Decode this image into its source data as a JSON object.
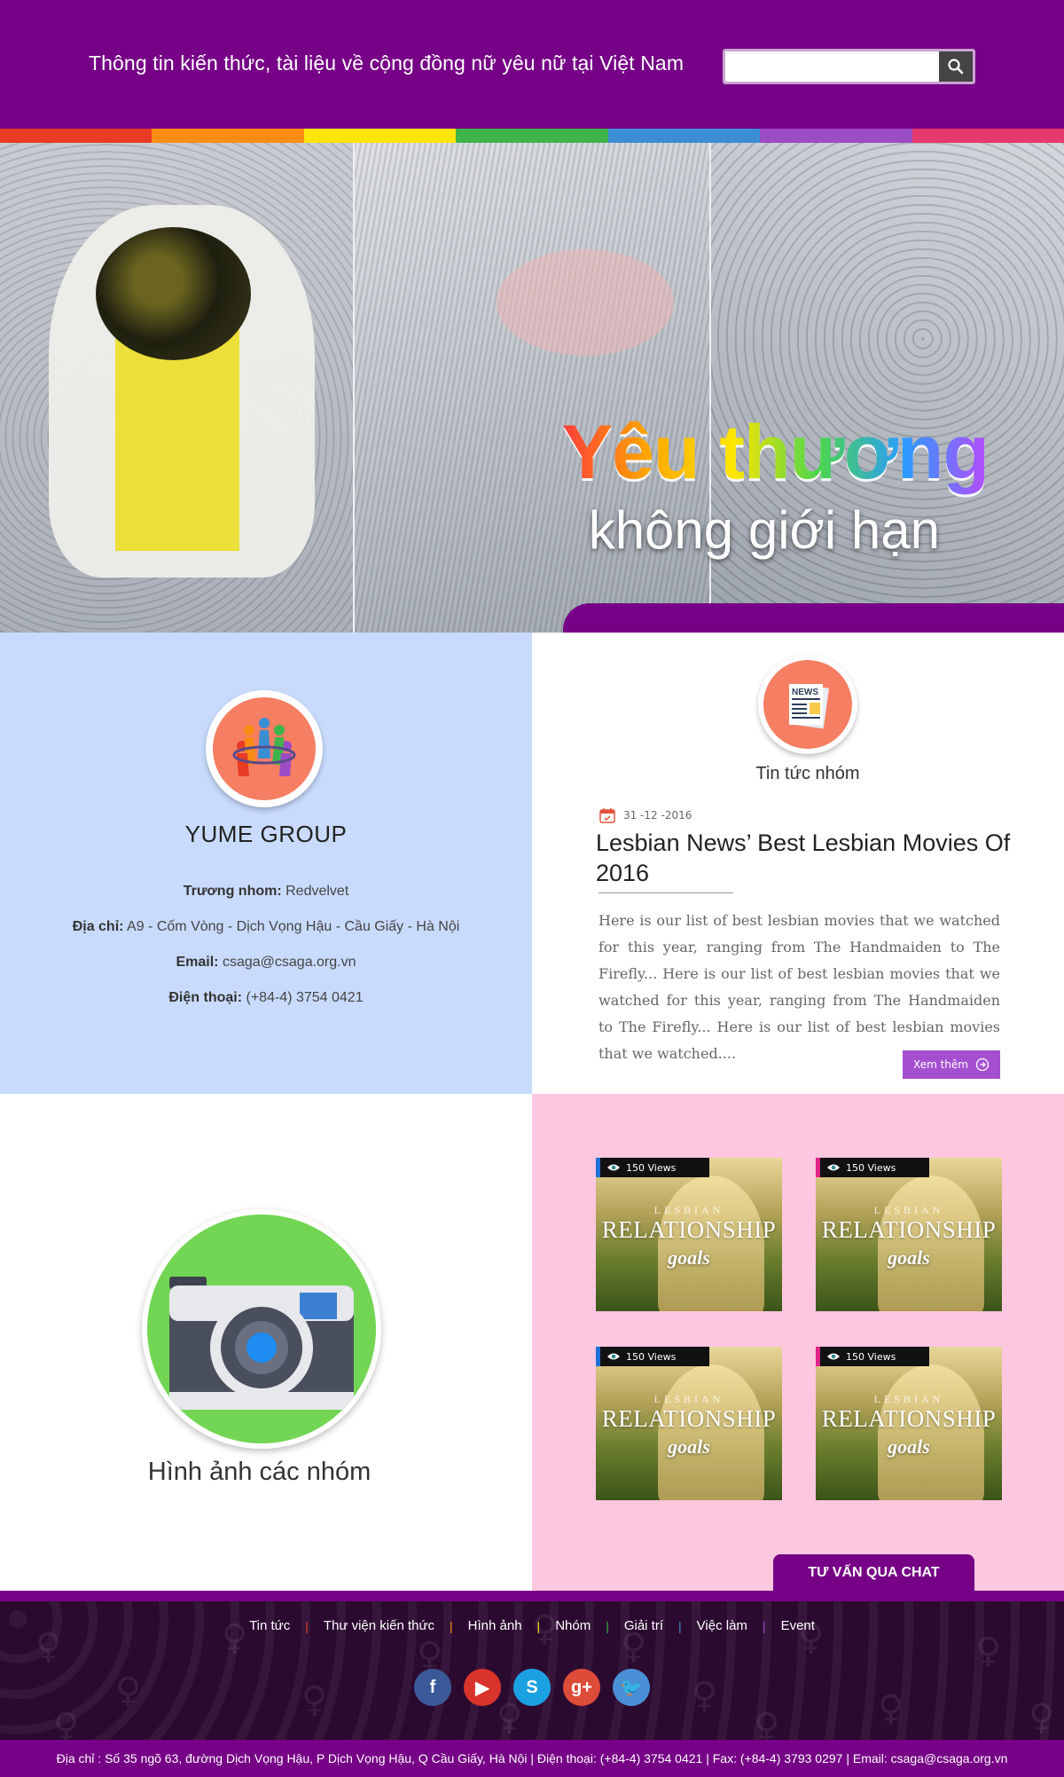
{
  "colors": {
    "header_bg": "#760086",
    "rainbow": [
      "#e83c24",
      "#fb8c14",
      "#fde50b",
      "#3fb44a",
      "#3a8fd4",
      "#9c4cc4",
      "#e53a6e"
    ],
    "group_bg": "#c8dbfd",
    "photos_bg": "#fdc7e0",
    "accent_button": "#a44fd0",
    "icon_orange": "#f57e63",
    "camera_green": "#72d654"
  },
  "header": {
    "title": "Thông tin kiến thức, tài liệu về cộng đồng nữ yêu nữ tại Việt Nam",
    "search": {
      "placeholder": "",
      "icon": "search-icon"
    }
  },
  "hero": {
    "line1": "Yêu thương",
    "line2": "không giới hạn"
  },
  "group": {
    "name": "YUME GROUP",
    "leader_label": "Trương nhom:",
    "leader_value": "Redvelvet",
    "address_label": "Địa chỉ:",
    "address_value": "A9 - Cốm Vòng - Dịch Vọng Hậu - Cầu Giấy - Hà Nội",
    "email_label": "Email:",
    "email_value": "csaga@csaga.org.vn",
    "phone_label": "Điện thoại:",
    "phone_value": "(+84-4) 3754 0421"
  },
  "news": {
    "heading": "Tin tức nhóm",
    "date": "31 -12 -2016",
    "title": "Lesbian News’ Best Lesbian Movies Of 2016",
    "excerpt": "Here is our list of best lesbian movies that we watched for this year, ranging from The Handmaiden to The Firefly... Here is our list of best lesbian movies that we watched for this year, ranging from The Handmaiden to The Firefly... Here is our list of best lesbian movies that we watched....",
    "more_label": "Xem thêm"
  },
  "photos": {
    "heading": "Hình ảnh các nhóm",
    "items": [
      {
        "views": "150 Views",
        "small": "LESBIAN",
        "big": "RELATIONSHIP",
        "script": "goals",
        "bar_color": "#1f6fd9"
      },
      {
        "views": "150 Views",
        "small": "LESBIAN",
        "big": "RELATIONSHIP",
        "script": "goals",
        "bar_color": "#e0248a"
      },
      {
        "views": "150 Views",
        "small": "LESBIAN",
        "big": "RELATIONSHIP",
        "script": "goals",
        "bar_color": "#1f6fd9"
      },
      {
        "views": "150 Views",
        "small": "LESBIAN",
        "big": "RELATIONSHIP",
        "script": "goals",
        "bar_color": "#e0248a"
      }
    ]
  },
  "chat_button": "TƯ VẤN QUA CHAT",
  "footer": {
    "nav": [
      "Tin tức",
      "Thư viện kiến thức",
      "Hình ảnh",
      "Nhóm",
      "Giải trí",
      "Việc làm",
      "Event"
    ],
    "nav_sep": "|",
    "nav_sep_colors": [
      "#e83c24",
      "#fb8c14",
      "#fde50b",
      "#3fb44a",
      "#3a8fd4",
      "#9c4cc4"
    ],
    "socials": [
      {
        "name": "facebook-icon",
        "glyph": "f",
        "color": "#3b5998"
      },
      {
        "name": "youtube-icon",
        "glyph": "▶",
        "color": "#d9342b"
      },
      {
        "name": "skype-icon",
        "glyph": "S",
        "color": "#1ba0e1"
      },
      {
        "name": "google-plus-icon",
        "glyph": "g+",
        "color": "#dd4b39"
      },
      {
        "name": "twitter-icon",
        "glyph": "🐦",
        "color": "#4a8fd6"
      }
    ],
    "bottom": "Địa chỉ : Số 35 ngõ 63, đường Dịch Vọng Hậu, P Dịch Vọng Hậu, Q Cầu Giấy, Hà Nội  |  Điện thoại: (+84-4) 3754 0421  |  Fax: (+84-4) 3793 0297  |  Email: csaga@csaga.org.vn"
  }
}
